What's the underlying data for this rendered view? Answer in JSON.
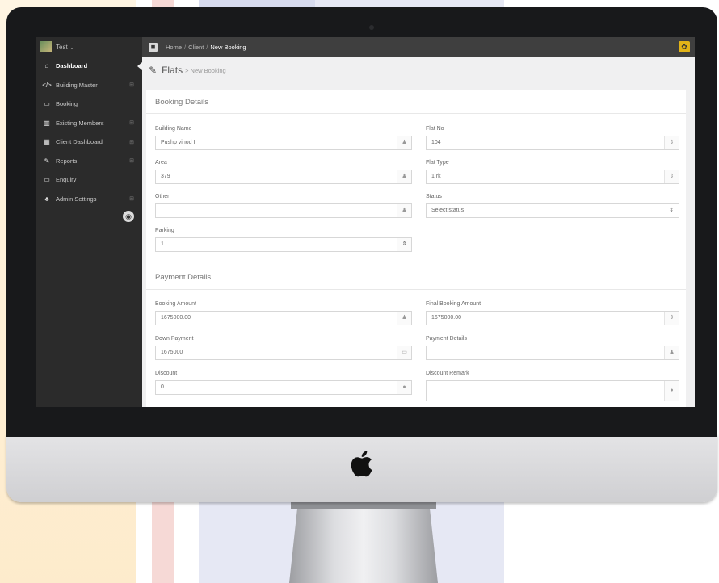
{
  "sidebar": {
    "user": "Test",
    "items": [
      {
        "label": "Dashboard",
        "icon": "home-icon",
        "glyph": "⌂",
        "expandable": false,
        "active": true
      },
      {
        "label": "Building Master",
        "icon": "code-icon",
        "glyph": "</>",
        "expandable": true
      },
      {
        "label": "Booking",
        "icon": "inbox-icon",
        "glyph": "▭",
        "expandable": false
      },
      {
        "label": "Existing Members",
        "icon": "bar-chart-icon",
        "glyph": "▥",
        "expandable": true
      },
      {
        "label": "Client Dashboard",
        "icon": "table-icon",
        "glyph": "▦",
        "expandable": true
      },
      {
        "label": "Reports",
        "icon": "edit-icon",
        "glyph": "✎",
        "expandable": true
      },
      {
        "label": "Enquiry",
        "icon": "monitor-icon",
        "glyph": "▭",
        "expandable": false
      },
      {
        "label": "Admin Settings",
        "icon": "sitemap-icon",
        "glyph": "♣",
        "expandable": true
      }
    ]
  },
  "breadcrumb": {
    "home": "Home",
    "client": "Client",
    "current": "New Booking"
  },
  "page": {
    "title": "Flats",
    "subtitle": "> New Booking"
  },
  "booking_details": {
    "title": "Booking Details",
    "building_name": {
      "label": "Building Name",
      "value": "Pushp vinod I",
      "icon": "user-icon"
    },
    "flat_no": {
      "label": "Flat No",
      "value": "104",
      "icon": "stepper-icon"
    },
    "area": {
      "label": "Area",
      "value": "379",
      "icon": "user-icon"
    },
    "flat_type": {
      "label": "Flat Type",
      "value": "1 rk",
      "icon": "stepper-icon"
    },
    "other": {
      "label": "Other",
      "value": "",
      "icon": "user-icon"
    },
    "status": {
      "label": "Status",
      "value": "Select status",
      "icon": "select-arrow-icon"
    },
    "parking": {
      "label": "Parking",
      "value": "1",
      "icon": "stepper-icon"
    }
  },
  "payment_details": {
    "title": "Payment Details",
    "booking_amount": {
      "label": "Booking Amount",
      "value": "1675000.00",
      "icon": "user-icon"
    },
    "final_booking_amount": {
      "label": "Final Booking Amount",
      "value": "1675000.00",
      "icon": "stepper-icon"
    },
    "down_payment": {
      "label": "Down Payment",
      "value": "1675000",
      "icon": "card-icon"
    },
    "payment_details": {
      "label": "Payment Details",
      "value": "",
      "icon": "user-icon"
    },
    "discount": {
      "label": "Discount",
      "value": "0",
      "icon": "comment-icon"
    },
    "discount_remark": {
      "label": "Discount Remark",
      "value": "",
      "icon": "comment-icon"
    }
  },
  "colors": {
    "sidebar_bg": "#2b2b2b",
    "topbar_bg": "#3f3f3f",
    "accent_gear": "#e2b317",
    "bezel": "#18191b"
  }
}
